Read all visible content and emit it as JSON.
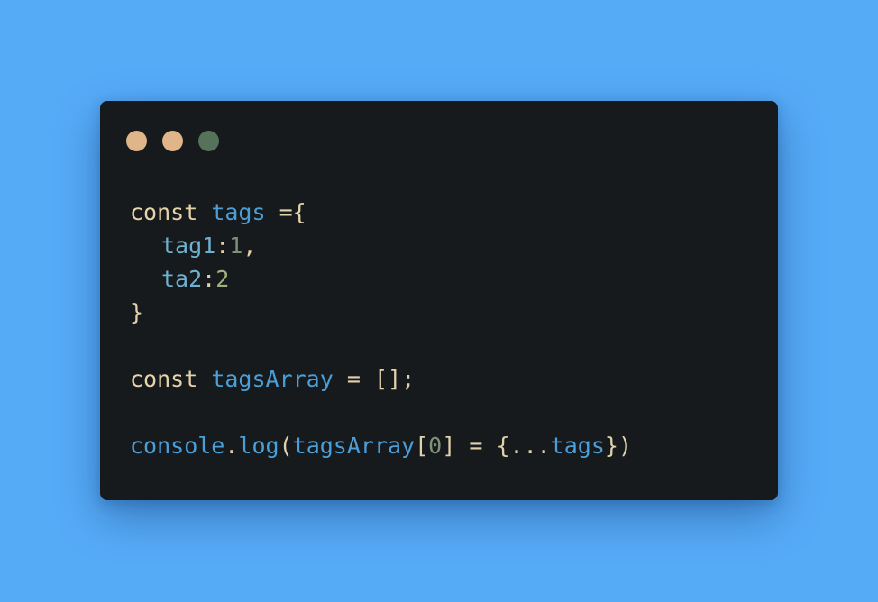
{
  "colors": {
    "background": "#56abf7",
    "window": "#171a1c",
    "keyword": "#e6d3a8",
    "identifier": "#4a9fd9",
    "property": "#6eb0cf",
    "number": "#9fb27d"
  },
  "window_controls": [
    {
      "name": "close",
      "color": "#e0b58a"
    },
    {
      "name": "minimize",
      "color": "#e0b58a"
    },
    {
      "name": "maximize",
      "color": "#57725a"
    }
  ],
  "code": {
    "line1": {
      "kw": "const",
      "name": "tags",
      "rest": "={"
    },
    "line2": {
      "key": "tag1",
      "colon": ":",
      "value": "1",
      "comma": ","
    },
    "line3": {
      "key": "ta2",
      "colon": ":",
      "value": "2"
    },
    "line4": {
      "brace": "}"
    },
    "line6": {
      "kw": "const",
      "name": "tagsArray",
      "rest": "= [];"
    },
    "line8": {
      "obj": "console",
      "dot": ".",
      "fn": "log",
      "open": "(",
      "arr": "tagsArray",
      "bracket_open": "[",
      "index": "0",
      "bracket_close": "]",
      "assign": " = {",
      "spread": "...",
      "spread_name": "tags",
      "close": "})"
    }
  }
}
